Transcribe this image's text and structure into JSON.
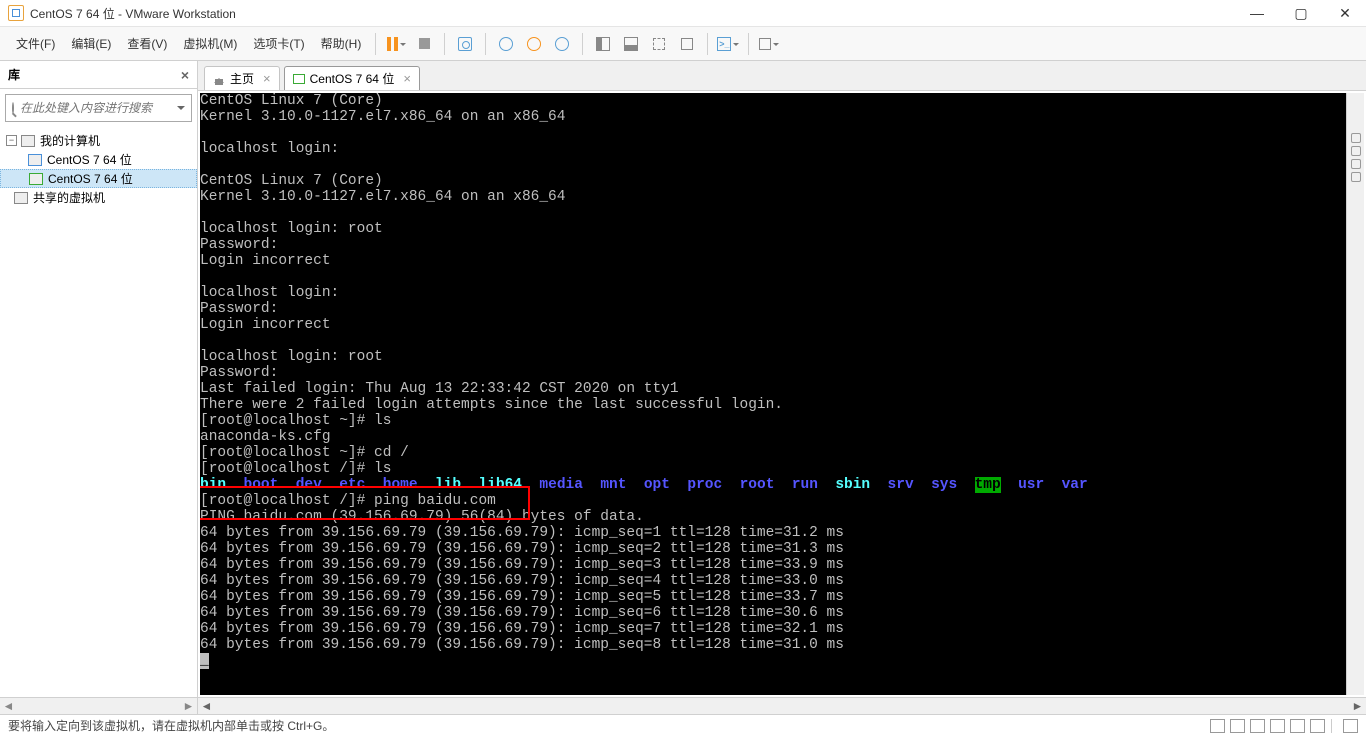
{
  "window": {
    "title": "CentOS 7 64 位 - VMware Workstation"
  },
  "menu": {
    "file": "文件(F)",
    "edit": "编辑(E)",
    "view": "查看(V)",
    "vm": "虚拟机(M)",
    "tabs": "选项卡(T)",
    "help": "帮助(H)"
  },
  "sidebar": {
    "title": "库",
    "search_placeholder": "在此处键入内容进行搜索",
    "my_computer": "我的计算机",
    "vm1": "CentOS 7 64 位",
    "vm2": "CentOS 7 64 位",
    "shared": "共享的虚拟机"
  },
  "tabs": {
    "home": "主页",
    "vm": "CentOS 7 64 位"
  },
  "terminal": {
    "l1": "CentOS Linux 7 (Core)",
    "l2": "Kernel 3.10.0-1127.el7.x86_64 on an x86_64",
    "l3": "",
    "l4": "localhost login:",
    "l5": "",
    "l6": "CentOS Linux 7 (Core)",
    "l7": "Kernel 3.10.0-1127.el7.x86_64 on an x86_64",
    "l8": "",
    "l9": "localhost login: root",
    "l10": "Password:",
    "l11": "Login incorrect",
    "l12": "",
    "l13": "localhost login:",
    "l14": "Password:",
    "l15": "Login incorrect",
    "l16": "",
    "l17": "localhost login: root",
    "l18": "Password:",
    "l19": "Last failed login: Thu Aug 13 22:33:42 CST 2020 on tty1",
    "l20": "There were 2 failed login attempts since the last successful login.",
    "l21": "[root@localhost ~]# ls",
    "l22": "anaconda-ks.cfg",
    "l23": "[root@localhost ~]# cd /",
    "l24": "[root@localhost /]# ls",
    "dirs": {
      "bin": "bin",
      "boot": "boot",
      "dev": "dev",
      "etc": "etc",
      "home": "home",
      "lib": "lib",
      "lib64": "lib64",
      "media": "media",
      "mnt": "mnt",
      "opt": "opt",
      "proc": "proc",
      "root": "root",
      "run": "run",
      "sbin": "sbin",
      "srv": "srv",
      "sys": "sys",
      "tmp": "tmp",
      "usr": "usr",
      "var": "var"
    },
    "l26": "[root@localhost /]# ping baidu.com",
    "l27": "PING baidu.com (39.156.69.79) 56(84) bytes of data.",
    "l28": "64 bytes from 39.156.69.79 (39.156.69.79): icmp_seq=1 ttl=128 time=31.2 ms",
    "l29": "64 bytes from 39.156.69.79 (39.156.69.79): icmp_seq=2 ttl=128 time=31.3 ms",
    "l30": "64 bytes from 39.156.69.79 (39.156.69.79): icmp_seq=3 ttl=128 time=33.9 ms",
    "l31": "64 bytes from 39.156.69.79 (39.156.69.79): icmp_seq=4 ttl=128 time=33.0 ms",
    "l32": "64 bytes from 39.156.69.79 (39.156.69.79): icmp_seq=5 ttl=128 time=33.7 ms",
    "l33": "64 bytes from 39.156.69.79 (39.156.69.79): icmp_seq=6 ttl=128 time=30.6 ms",
    "l34": "64 bytes from 39.156.69.79 (39.156.69.79): icmp_seq=7 ttl=128 time=32.1 ms",
    "l35": "64 bytes from 39.156.69.79 (39.156.69.79): icmp_seq=8 ttl=128 time=31.0 ms"
  },
  "status": {
    "text": "要将输入定向到该虚拟机，请在虚拟机内部单击或按 Ctrl+G。"
  }
}
